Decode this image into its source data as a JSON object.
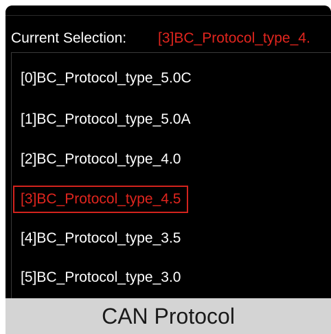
{
  "header": {
    "current_selection_label": "Current Selection:",
    "current_selection_value": "[3]BC_Protocol_type_4."
  },
  "list": {
    "items": [
      {
        "label": "[0]BC_Protocol_type_5.0C",
        "selected": false
      },
      {
        "label": "[1]BC_Protocol_type_5.0A",
        "selected": false
      },
      {
        "label": "[2]BC_Protocol_type_4.0",
        "selected": false
      },
      {
        "label": "[3]BC_Protocol_type_4.5",
        "selected": true
      },
      {
        "label": "[4]BC_Protocol_type_3.5",
        "selected": false
      },
      {
        "label": "[5]BC_Protocol_type_3.0",
        "selected": false
      }
    ]
  },
  "footer": {
    "title": "CAN Protocol"
  },
  "colors": {
    "background": "#000000",
    "text": "#ffffff",
    "accent_red": "#e0251e",
    "footer_bg": "#d4d4d4"
  }
}
